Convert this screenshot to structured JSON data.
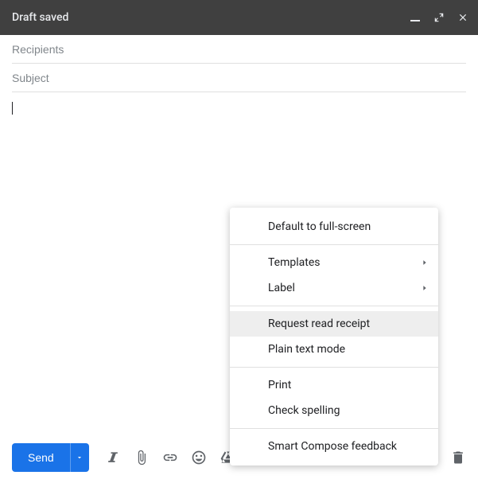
{
  "header": {
    "title": "Draft saved"
  },
  "fields": {
    "recipients_placeholder": "Recipients",
    "recipients_value": "",
    "subject_placeholder": "Subject",
    "subject_value": ""
  },
  "body": {
    "content": ""
  },
  "toolbar": {
    "send_label": "Send",
    "icons": {
      "format": "formatting-options-icon",
      "attach": "attach-files-icon",
      "link": "insert-link-icon",
      "emoji": "insert-emoji-icon",
      "drive": "insert-drive-file-icon",
      "photo": "insert-photo-icon",
      "confidential": "confidential-mode-icon",
      "signature": "insert-signature-icon",
      "more": "more-options-icon",
      "discard": "discard-draft-icon"
    }
  },
  "menu": {
    "items": [
      {
        "label": "Default to full-screen",
        "submenu": false,
        "highlight": false
      },
      {
        "sep": true
      },
      {
        "label": "Templates",
        "submenu": true,
        "highlight": false
      },
      {
        "label": "Label",
        "submenu": true,
        "highlight": false
      },
      {
        "sep": true
      },
      {
        "label": "Request read receipt",
        "submenu": false,
        "highlight": true
      },
      {
        "label": "Plain text mode",
        "submenu": false,
        "highlight": false
      },
      {
        "sep": true
      },
      {
        "label": "Print",
        "submenu": false,
        "highlight": false
      },
      {
        "label": "Check spelling",
        "submenu": false,
        "highlight": false
      },
      {
        "sep": true
      },
      {
        "label": "Smart Compose feedback",
        "submenu": false,
        "highlight": false
      }
    ]
  }
}
